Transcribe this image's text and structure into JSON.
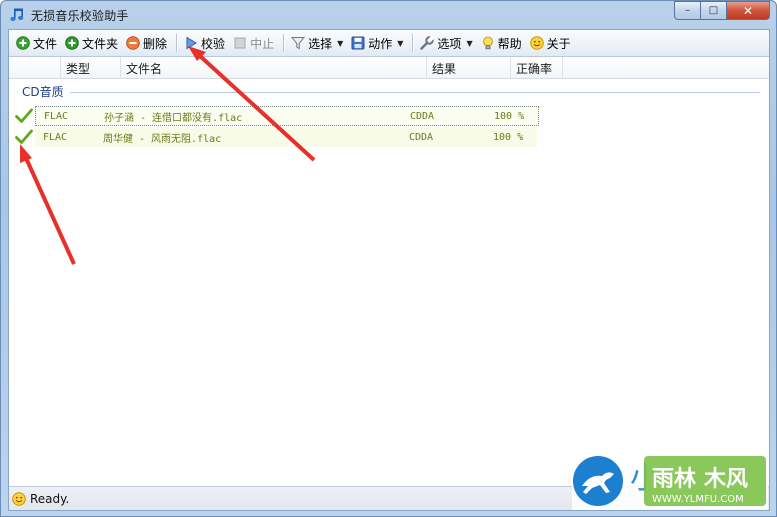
{
  "window": {
    "title": "无损音乐校验助手",
    "app_icon": "music-note-icon"
  },
  "window_controls": {
    "minimize": "–",
    "maximize": "□",
    "close": "✕"
  },
  "toolbar": {
    "file_label": "文件",
    "folder_label": "文件夹",
    "delete_label": "删除",
    "verify_label": "校验",
    "stop_label": "中止",
    "select_label": "选择",
    "action_label": "动作",
    "options_label": "选项",
    "help_label": "帮助",
    "about_label": "关于"
  },
  "columns": [
    "类型",
    "文件名",
    "结果",
    "正确率"
  ],
  "group": {
    "label": "CD音质"
  },
  "rows": [
    {
      "type": "FLAC",
      "filename": "孙子涵 - 连借口都没有.flac",
      "result": "CDDA",
      "accuracy": "100 %",
      "status_icon": "check-icon"
    },
    {
      "type": "FLAC",
      "filename": "周华健 - 风雨无阻.flac",
      "result": "CDDA",
      "accuracy": "100 %",
      "status_icon": "check-icon"
    }
  ],
  "status_bar": {
    "text": "Ready."
  },
  "watermark": {
    "text": "WWW.YLMFU.COM",
    "brand": "雨林木风"
  },
  "colors": {
    "accent_arrow": "#e8302a",
    "row_text": "#6c7a19",
    "group_text": "#1e3e8a"
  }
}
